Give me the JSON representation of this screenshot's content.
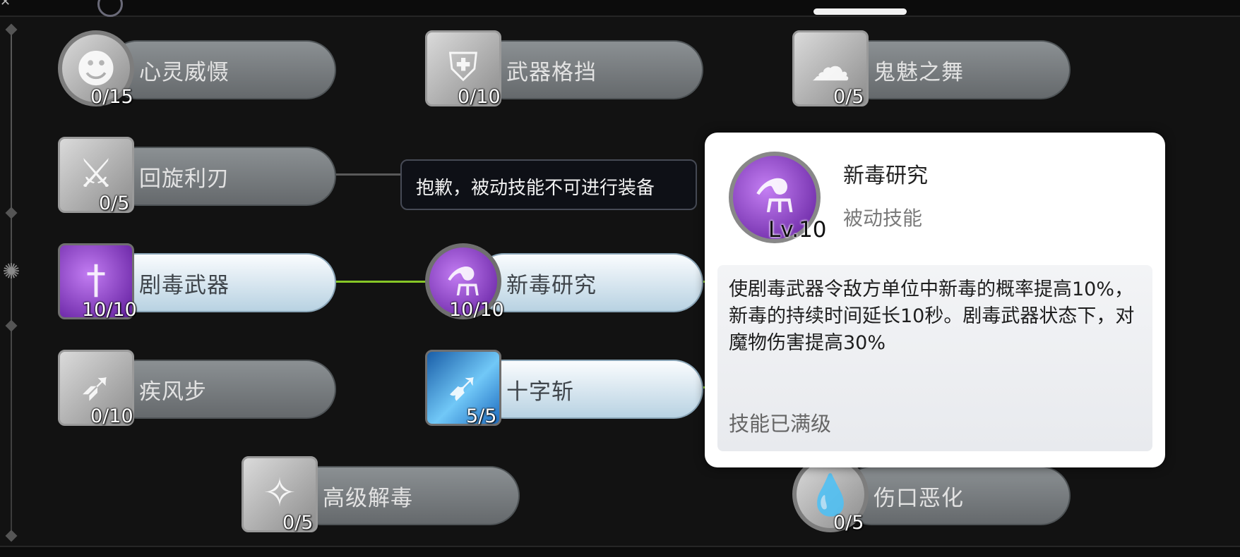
{
  "tooltip": {
    "message": "抱歉，被动技能不可进行装备"
  },
  "skills": [
    {
      "name": "心灵威慑",
      "level": "0/15",
      "icon": "mind-icon"
    },
    {
      "name": "武器格挡",
      "level": "0/10",
      "icon": "shield-icon"
    },
    {
      "name": "鬼魅之舞",
      "level": "0/5",
      "icon": "ghost-icon"
    },
    {
      "name": "回旋利刃",
      "level": "0/5",
      "icon": "blade-icon"
    },
    {
      "name": "剧毒武器",
      "level": "10/10",
      "icon": "poison-weapon-icon"
    },
    {
      "name": "新毒研究",
      "level": "10/10",
      "icon": "poison-flask-icon"
    },
    {
      "name": "疾风步",
      "level": "0/10",
      "icon": "boot-icon"
    },
    {
      "name": "十字斩",
      "level": "5/5",
      "icon": "slash-icon"
    },
    {
      "name": "高级解毒",
      "level": "0/5",
      "icon": "antidote-icon"
    },
    {
      "name": "伤口恶化",
      "level": "0/5",
      "icon": "blood-drop-icon"
    }
  ],
  "detail": {
    "name": "新毒研究",
    "level": "Lv.10",
    "type": "被动技能",
    "description": "使剧毒武器令敌方单位中新毒的概率提高10%，新毒的持续时间延长10秒。剧毒武器状态下，对魔物伤害提高30%",
    "status": "技能已满级",
    "icon": "poison-flask-icon"
  },
  "colors": {
    "active_pill": "#d8e8f2",
    "inactive_pill": "#7a7e81",
    "connector_active": "#86c626",
    "poison_purple": "#8a3fd0",
    "background": "#121212"
  }
}
